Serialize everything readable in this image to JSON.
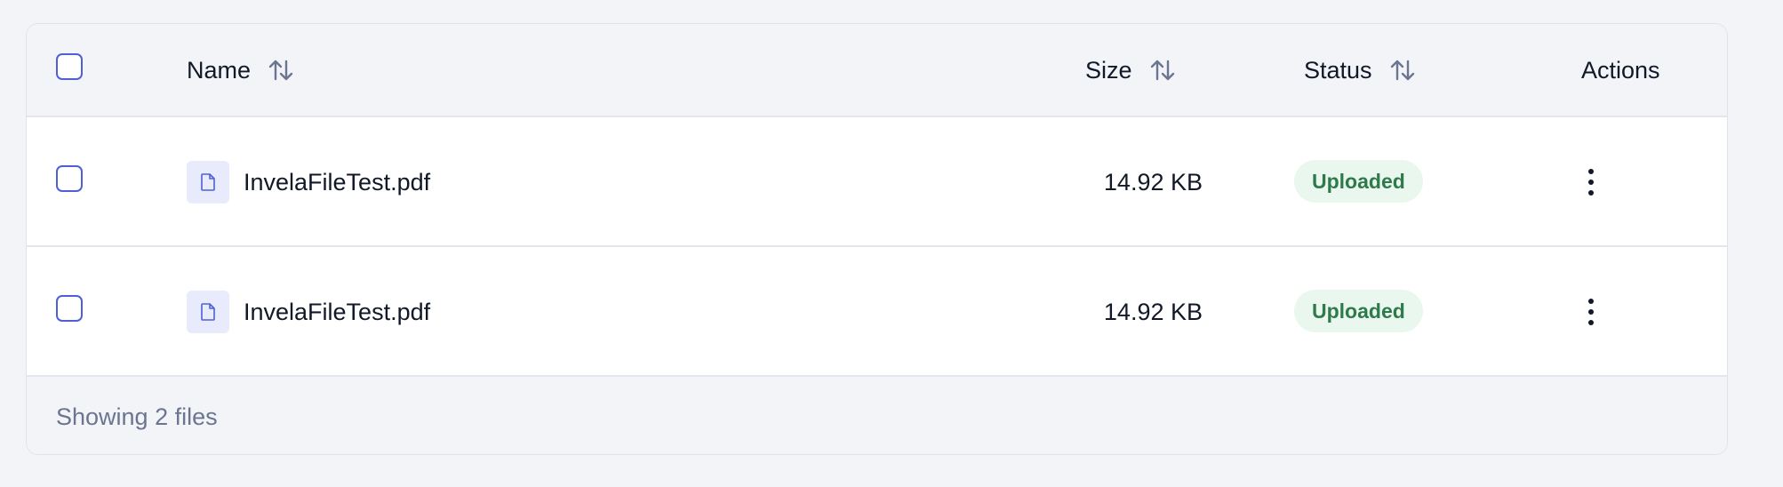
{
  "header": {
    "columns": {
      "name": "Name",
      "size": "Size",
      "status": "Status",
      "actions": "Actions"
    }
  },
  "rows": [
    {
      "name": "InvelaFileTest.pdf",
      "size": "14.92 KB",
      "status": "Uploaded"
    },
    {
      "name": "InvelaFileTest.pdf",
      "size": "14.92 KB",
      "status": "Uploaded"
    }
  ],
  "footer": {
    "text": "Showing 2 files"
  },
  "colors": {
    "accent": "#4f5fd6",
    "status_bg": "#e9f7ef",
    "status_text": "#2f7a4b",
    "header_bg": "#f2f4f8"
  },
  "icons": {
    "sort": "sort-arrows-icon",
    "file": "file-document-icon",
    "actions": "more-vertical-icon"
  }
}
